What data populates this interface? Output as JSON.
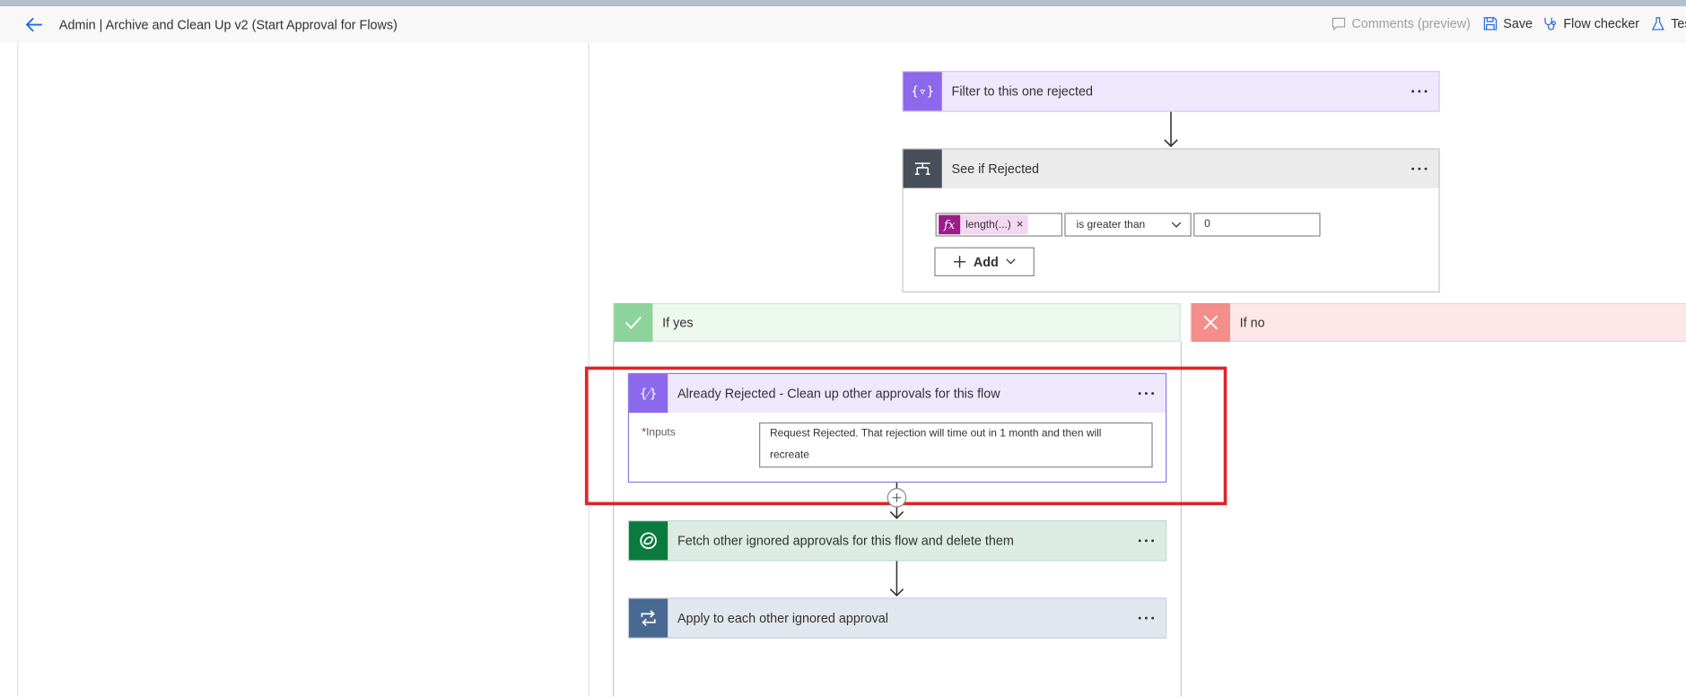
{
  "header": {
    "title": "Admin | Archive and Clean Up v2 (Start Approval for Flows)",
    "comments_label": "Comments (preview)",
    "save_label": "Save",
    "flow_checker_label": "Flow checker",
    "test_label": "Test"
  },
  "flow": {
    "filter_step": {
      "title": "Filter to this one rejected",
      "icon": "filter-array-icon",
      "color": "#8c68ec"
    },
    "condition_step": {
      "title": "See if Rejected",
      "icon": "condition-icon",
      "color": "#484f58",
      "token_label": "length(...)",
      "token_remove": "×",
      "token_icon_text": "fx",
      "operator": "is greater than",
      "value": "0",
      "add_label": "Add"
    },
    "branch_yes": {
      "label": "If yes",
      "icon": "check-icon",
      "color": "#8ed39c"
    },
    "branch_no": {
      "label": "If no",
      "icon": "close-icon",
      "color": "#f38e8a"
    },
    "compose_step": {
      "title": "Already Rejected - Clean up other approvals for this flow",
      "icon": "compose-icon",
      "inputs_label": "Inputs",
      "required_mark": "*",
      "inputs_value": "Request Rejected. That rejection will time out in 1 month and then will recreate"
    },
    "fetch_step": {
      "title": "Fetch other ignored approvals for this flow and delete them",
      "icon": "dataverse-icon",
      "color": "#0b7a3e"
    },
    "apply_step": {
      "title": "Apply to each other ignored approval",
      "icon": "loop-icon",
      "color": "#486991"
    }
  }
}
